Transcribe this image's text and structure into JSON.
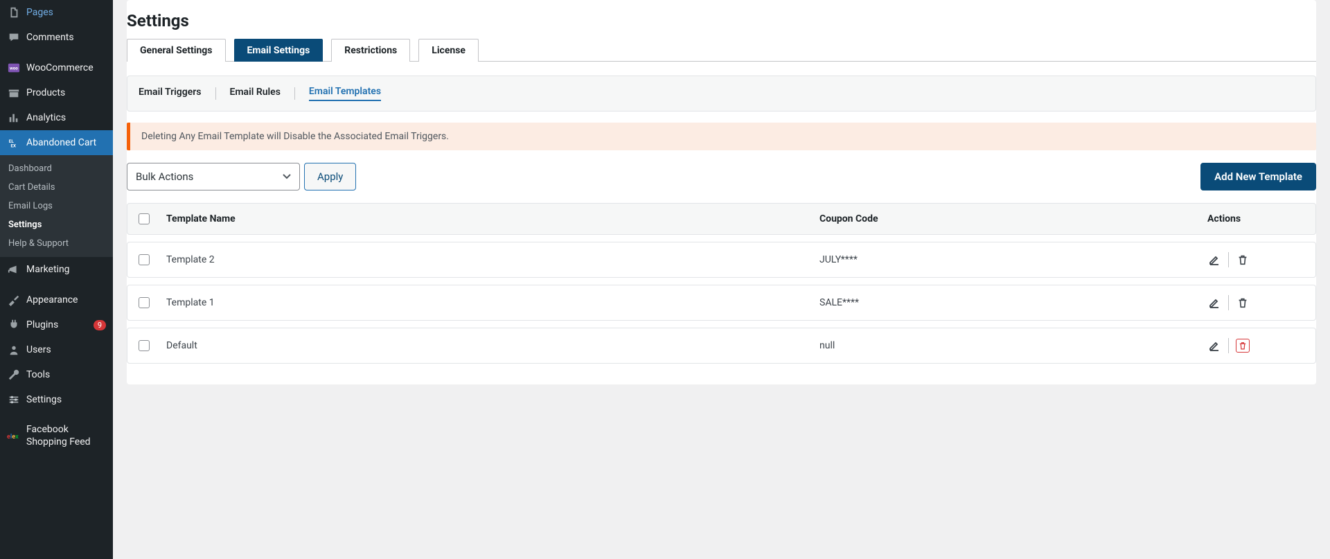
{
  "sidebar": {
    "items": [
      {
        "id": "pages",
        "label": "Pages"
      },
      {
        "id": "comments",
        "label": "Comments"
      },
      {
        "id": "woocommerce",
        "label": "WooCommerce"
      },
      {
        "id": "products",
        "label": "Products"
      },
      {
        "id": "analytics",
        "label": "Analytics"
      },
      {
        "id": "abandoned-cart",
        "label": "Abandoned Cart"
      },
      {
        "id": "marketing",
        "label": "Marketing"
      },
      {
        "id": "appearance",
        "label": "Appearance"
      },
      {
        "id": "plugins",
        "label": "Plugins",
        "badge": "9"
      },
      {
        "id": "users",
        "label": "Users"
      },
      {
        "id": "tools",
        "label": "Tools"
      },
      {
        "id": "settings",
        "label": "Settings"
      },
      {
        "id": "fb-feed",
        "label": "Facebook Shopping Feed"
      }
    ],
    "submenu": [
      {
        "id": "dashboard",
        "label": "Dashboard"
      },
      {
        "id": "cart-details",
        "label": "Cart Details"
      },
      {
        "id": "email-logs",
        "label": "Email Logs"
      },
      {
        "id": "settings",
        "label": "Settings"
      },
      {
        "id": "help",
        "label": "Help & Support"
      }
    ]
  },
  "page": {
    "title": "Settings"
  },
  "tabs": [
    {
      "id": "general",
      "label": "General Settings"
    },
    {
      "id": "email",
      "label": "Email Settings"
    },
    {
      "id": "restrictions",
      "label": "Restrictions"
    },
    {
      "id": "license",
      "label": "License"
    }
  ],
  "subtabs": [
    {
      "id": "triggers",
      "label": "Email Triggers"
    },
    {
      "id": "rules",
      "label": "Email Rules"
    },
    {
      "id": "templates",
      "label": "Email Templates"
    }
  ],
  "alert": {
    "text": "Deleting Any Email Template will Disable the Associated Email Triggers."
  },
  "toolbar": {
    "bulk_label": "Bulk Actions",
    "apply_label": "Apply",
    "add_label": "Add New Template"
  },
  "table": {
    "headers": {
      "name": "Template Name",
      "code": "Coupon Code",
      "actions": "Actions"
    },
    "rows": [
      {
        "name": "Template 2",
        "code": "JULY****",
        "danger": false
      },
      {
        "name": "Template 1",
        "code": "SALE****",
        "danger": false
      },
      {
        "name": "Default",
        "code": "null",
        "danger": true
      }
    ]
  }
}
